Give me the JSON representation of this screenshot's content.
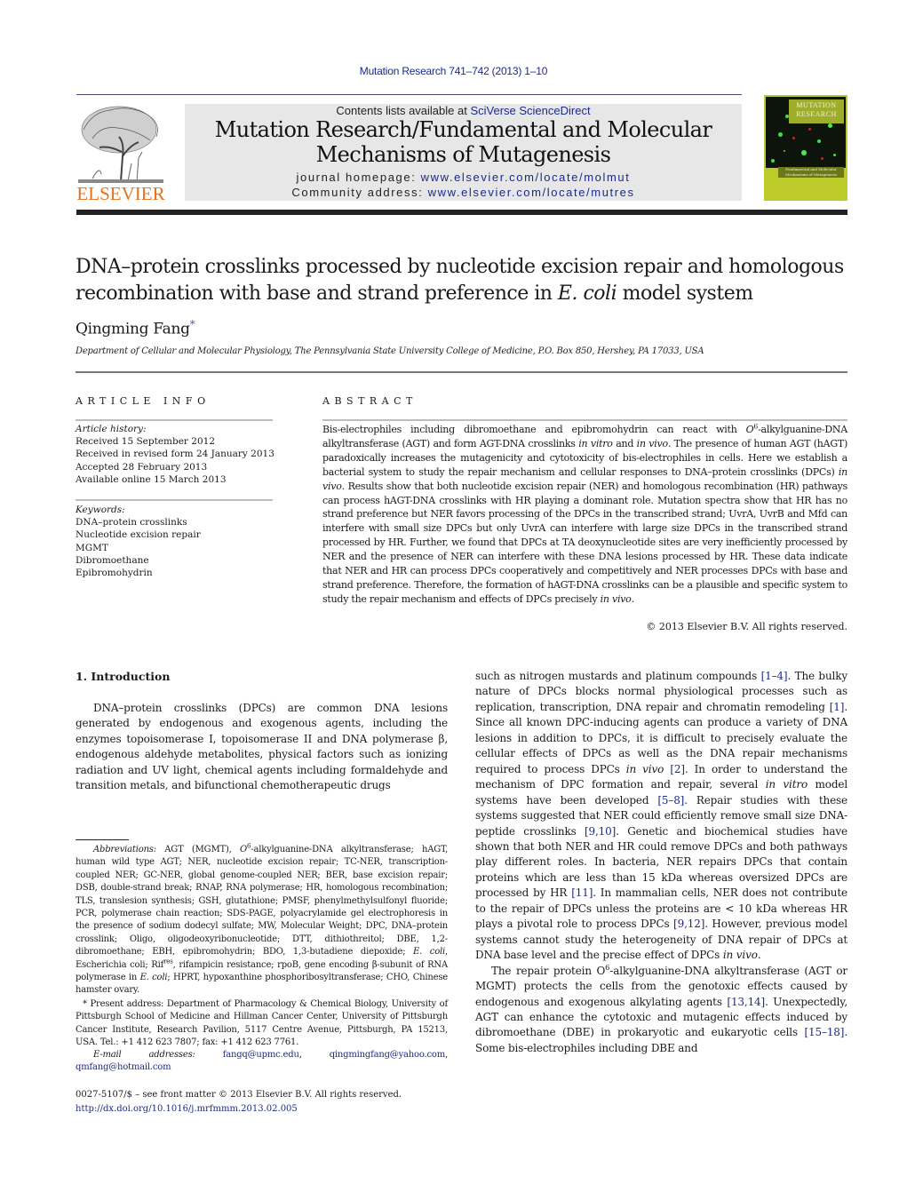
{
  "running_head": "Mutation Research 741–742 (2013) 1–10",
  "publisher": {
    "logo_wordmark": "ELSEVIER",
    "logo_icon": "elsevier-tree-icon",
    "brand_color": "#e9711c"
  },
  "journal_header": {
    "contents_prefix": "Contents lists available at ",
    "contents_link": "SciVerse ScienceDirect",
    "title_line1": "Mutation Research/Fundamental and Molecular",
    "title_line2": "Mechanisms of Mutagenesis",
    "homepage_label": "journal homepage: ",
    "homepage_url": "www.elsevier.com/locate/molmut",
    "community_label": "Community address: ",
    "community_url": "www.elsevier.com/locate/mutres",
    "link_color": "#1b2a8a",
    "box_color": "#e7e7e7"
  },
  "cover": {
    "title_line1": "MUTATION",
    "title_line2": "RESEARCH",
    "subtitle": "Fundamental and Molecular Mechanisms of Mutagenesis",
    "accent_color": "#bccb2a"
  },
  "article": {
    "title_part1": "DNA–protein crosslinks processed by nucleotide excision repair and homologous recombination with base and strand preference in ",
    "title_italic": "E. coli",
    "title_part2": " model system",
    "author": "Qingming Fang",
    "author_mark": "*",
    "affiliation": "Department of Cellular and Molecular Physiology, The Pennsylvania State University College of Medicine, P.O. Box 850, Hershey, PA 17033, USA"
  },
  "article_info": {
    "heading": "ARTICLE INFO",
    "history_label": "Article history:",
    "history": [
      "Received 15 September 2012",
      "Received in revised form 24 January 2013",
      "Accepted 28 February 2013",
      "Available online 15 March 2013"
    ],
    "keywords_label": "Keywords:",
    "keywords": [
      "DNA–protein crosslinks",
      "Nucleotide excision repair",
      "MGMT",
      "Dibromoethane",
      "Epibromohydrin"
    ]
  },
  "abstract": {
    "heading": "ABSTRACT",
    "s1": "Bis-electrophiles including dibromoethane and epibromohydrin can react with ",
    "s1_o": "O",
    "s1_sup": "6",
    "s2": "-alkylguanine-DNA alkyltransferase (AGT) and form AGT-DNA crosslinks ",
    "s2_it1": "in vitro",
    "s2_and": " and ",
    "s2_it2": "in vivo",
    "s3": ". The presence of human AGT (hAGT) paradoxically increases the mutagenicity and cytotoxicity of bis-electrophiles in cells. Here we establish a bacterial system to study the repair mechanism and cellular responses to DNA–protein crosslinks (DPCs) ",
    "s3_it": "in vivo",
    "s4": ". Results show that both nucleotide excision repair (NER) and homologous recombination (HR) pathways can process hAGT-DNA crosslinks with HR playing a dominant role. Mutation spectra show that HR has no strand preference but NER favors processing of the DPCs in the transcribed strand; UvrA, UvrB and Mfd can interfere with small size DPCs but only UvrA can interfere with large size DPCs in the transcribed strand processed by HR. Further, we found that DPCs at TA deoxynucleotide sites are very inefficiently processed by NER and the presence of NER can interfere with these DNA lesions processed by HR. These data indicate that NER and HR can process DPCs cooperatively and competitively and NER processes DPCs with base and strand preference. Therefore, the formation of hAGT-DNA crosslinks can be a plausible and specific system to study the repair mechanism and effects of DPCs precisely ",
    "s4_it": "in vivo",
    "s5": ".",
    "copyright": "© 2013 Elsevier B.V. All rights reserved."
  },
  "introduction": {
    "heading": "1.  Introduction",
    "left_p1a": "DNA–protein crosslinks (DPCs) are common DNA lesions generated by endogenous and exogenous agents, including the enzymes topoisomerase I, topoisomerase II and DNA polymerase β, endogenous aldehyde metabolites, physical factors such as ionizing radiation and UV light, chemical agents including formaldehyde and transition metals, and bifunctional chemotherapeutic drugs",
    "right_p1": [
      {
        "t": "such as nitrogen mustards and platinum compounds "
      },
      {
        "r": "[1–4]"
      },
      {
        "t": ". The bulky nature of DPCs blocks normal physiological processes such as replication, transcription, DNA repair and chromatin remodeling "
      },
      {
        "r": "[1]"
      },
      {
        "t": ". Since all known DPC-inducing agents can produce a variety of DNA lesions in addition to DPCs, it is difficult to precisely evaluate the cellular effects of DPCs as well as the DNA repair mechanisms required to process DPCs "
      },
      {
        "i": "in vivo"
      },
      {
        "t": " "
      },
      {
        "r": "[2]"
      },
      {
        "t": ". In order to understand the mechanism of DPC formation and repair, several "
      },
      {
        "i": "in vitro"
      },
      {
        "t": " model systems have been developed "
      },
      {
        "r": "[5–8]"
      },
      {
        "t": ". Repair studies with these systems suggested that NER could efficiently remove small size DNA-peptide crosslinks "
      },
      {
        "r": "[9,10]"
      },
      {
        "t": ". Genetic and biochemical studies have shown that both NER and HR could remove DPCs and both pathways play different roles. In bacteria, NER repairs DPCs that contain proteins which are less than 15 kDa whereas oversized DPCs are processed by HR "
      },
      {
        "r": "[11]"
      },
      {
        "t": ". In mammalian cells, NER does not contribute to the repair of DPCs unless the proteins are < 10 kDa whereas HR plays a pivotal role to process DPCs "
      },
      {
        "r": "[9,12]"
      },
      {
        "t": ". However, previous model systems cannot study the heterogeneity of DNA repair of DPCs at DNA base level and the precise effect of DPCs "
      },
      {
        "i": "in vivo"
      },
      {
        "t": "."
      }
    ],
    "right_p2": [
      {
        "t": "The repair protein O"
      },
      {
        "s": "6"
      },
      {
        "t": "-alkylguanine-DNA alkyltransferase (AGT or MGMT) protects the cells from the genotoxic effects caused by endogenous and exogenous alkylating agents "
      },
      {
        "r": "[13,14]"
      },
      {
        "t": ". Unexpectedly, AGT can enhance the cytotoxic and mutagenic effects induced by dibromoethane (DBE) in prokaryotic and eukaryotic cells "
      },
      {
        "r": "[15–18]"
      },
      {
        "t": ". Some bis-electrophiles including DBE and"
      }
    ]
  },
  "footnotes": {
    "abbrev_label": "Abbreviations:",
    "abbrev": [
      {
        "t": "  AGT (MGMT), "
      },
      {
        "i": "O"
      },
      {
        "s": "6"
      },
      {
        "t": "-alkylguanine-DNA alkyltransferase; hAGT, human wild type AGT; NER, nucleotide excision repair; TC-NER, transcription-coupled NER; GC-NER, global genome-coupled NER; BER, base excision repair; DSB, double-strand break; RNAP, RNA polymerase; HR, homologous recombination; TLS, translesion synthesis; GSH, glutathione; PMSF, phenylmethylsulfonyl fluoride; PCR, polymerase chain reaction; SDS-PAGE, polyacrylamide gel electrophoresis in the presence of sodium dodecyl sulfate; MW, Molecular Weight; DPC, DNA–protein crosslink; Oligo, oligodeoxyribonucleotide; DTT, dithiothreitol; DBE, 1,2-dibromoethane; EBH, epibromohydrin; BDO, 1,3-butadiene diepoxide; "
      },
      {
        "i": "E. coli"
      },
      {
        "t": ", Escherichia coli; Rif"
      },
      {
        "s": "res"
      },
      {
        "t": ", rifampicin resistance; rpoB, gene encoding β-subunit of RNA polymerase in "
      },
      {
        "i": "E. coli"
      },
      {
        "t": "; HPRT, hypoxanthine phosphoribosyltransferase; CHO, Chinese hamster ovary."
      }
    ],
    "present_address": "* Present address: Department of Pharmacology & Chemical Biology, University of Pittsburgh School of Medicine and Hillman Cancer Center, University of Pittsburgh Cancer Institute, Research Pavilion, 5117 Centre Avenue, Pittsburgh, PA 15213, USA. Tel.: +1 412 623 7807; fax: +1 412 623 7761.",
    "email_label": "E-mail addresses:",
    "emails": [
      "fangq@upmc.edu",
      "qingmingfang@yahoo.com",
      "qmfang@hotmail.com"
    ],
    "front_matter": "0027-5107/$ – see front matter © 2013 Elsevier B.V. All rights reserved.",
    "doi": "http://dx.doi.org/10.1016/j.mrfmmm.2013.02.005"
  }
}
